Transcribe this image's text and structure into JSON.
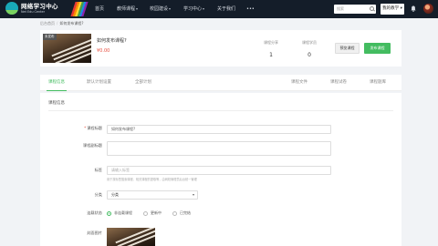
{
  "nav": {
    "logo_title": "网络学习中心",
    "logo_subtitle": "Net Edu Center",
    "items": [
      {
        "label": "首页",
        "dropdown": false
      },
      {
        "label": "教师课程",
        "dropdown": true
      },
      {
        "label": "校园建设",
        "dropdown": true
      },
      {
        "label": "学习中心",
        "dropdown": true
      },
      {
        "label": "关于我们",
        "dropdown": false
      },
      {
        "label": "•••",
        "dropdown": false
      }
    ],
    "search_placeholder": "搜索",
    "my_teaching": "我的教学",
    "my_teaching_caret": "▾",
    "caret": "▾"
  },
  "breadcrumb": {
    "root": "后台首页",
    "separator": "/",
    "current": "如何发布课程?"
  },
  "course": {
    "status_tag": "未发布",
    "title": "如何发布课程?",
    "price": "¥0.00",
    "stats": [
      {
        "label": "课程分享",
        "value": "1"
      },
      {
        "label": "课程学员",
        "value": "0"
      }
    ],
    "preview_button": "预览课程",
    "publish_button": "发布课程"
  },
  "tabs": {
    "left": [
      "课程信息",
      "默认计划设置",
      "全部计划"
    ],
    "right": [
      "课程文件",
      "课程试卷",
      "课程题库"
    ],
    "active": "课程信息"
  },
  "form": {
    "section_title": "课程信息",
    "title_label": "课程标题",
    "title_value": "如何发布课程?",
    "subtitle_label": "课程副标题",
    "subtitle_value": "",
    "tags_label": "标签",
    "tags_placeholder": "请输入标签",
    "tags_hint": "用于按标签搜索课程、相关课程的提取等，由网校管理员后台统一管理",
    "category_label": "分类",
    "category_value": "分类",
    "category_caret": "▾",
    "serialize_label": "连载状态",
    "serialize_options": [
      "非连载课程",
      "更新中",
      "已完结"
    ],
    "serialize_selected": 0,
    "cover_label": "封面图片"
  },
  "colors": {
    "accent_green": "#43bc60",
    "nav_bg": "#141d29",
    "price_red": "#e74c3c"
  }
}
